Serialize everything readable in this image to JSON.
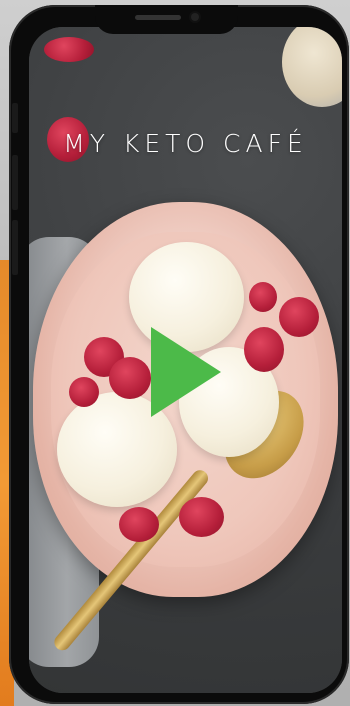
{
  "app": {
    "title": "MY KETO CAFÉ"
  },
  "video": {
    "play_icon": "play-icon",
    "accent_color": "#4cba49"
  },
  "colors": {
    "frame": "#0b0b0b",
    "accent_edge": "#f29a35"
  }
}
